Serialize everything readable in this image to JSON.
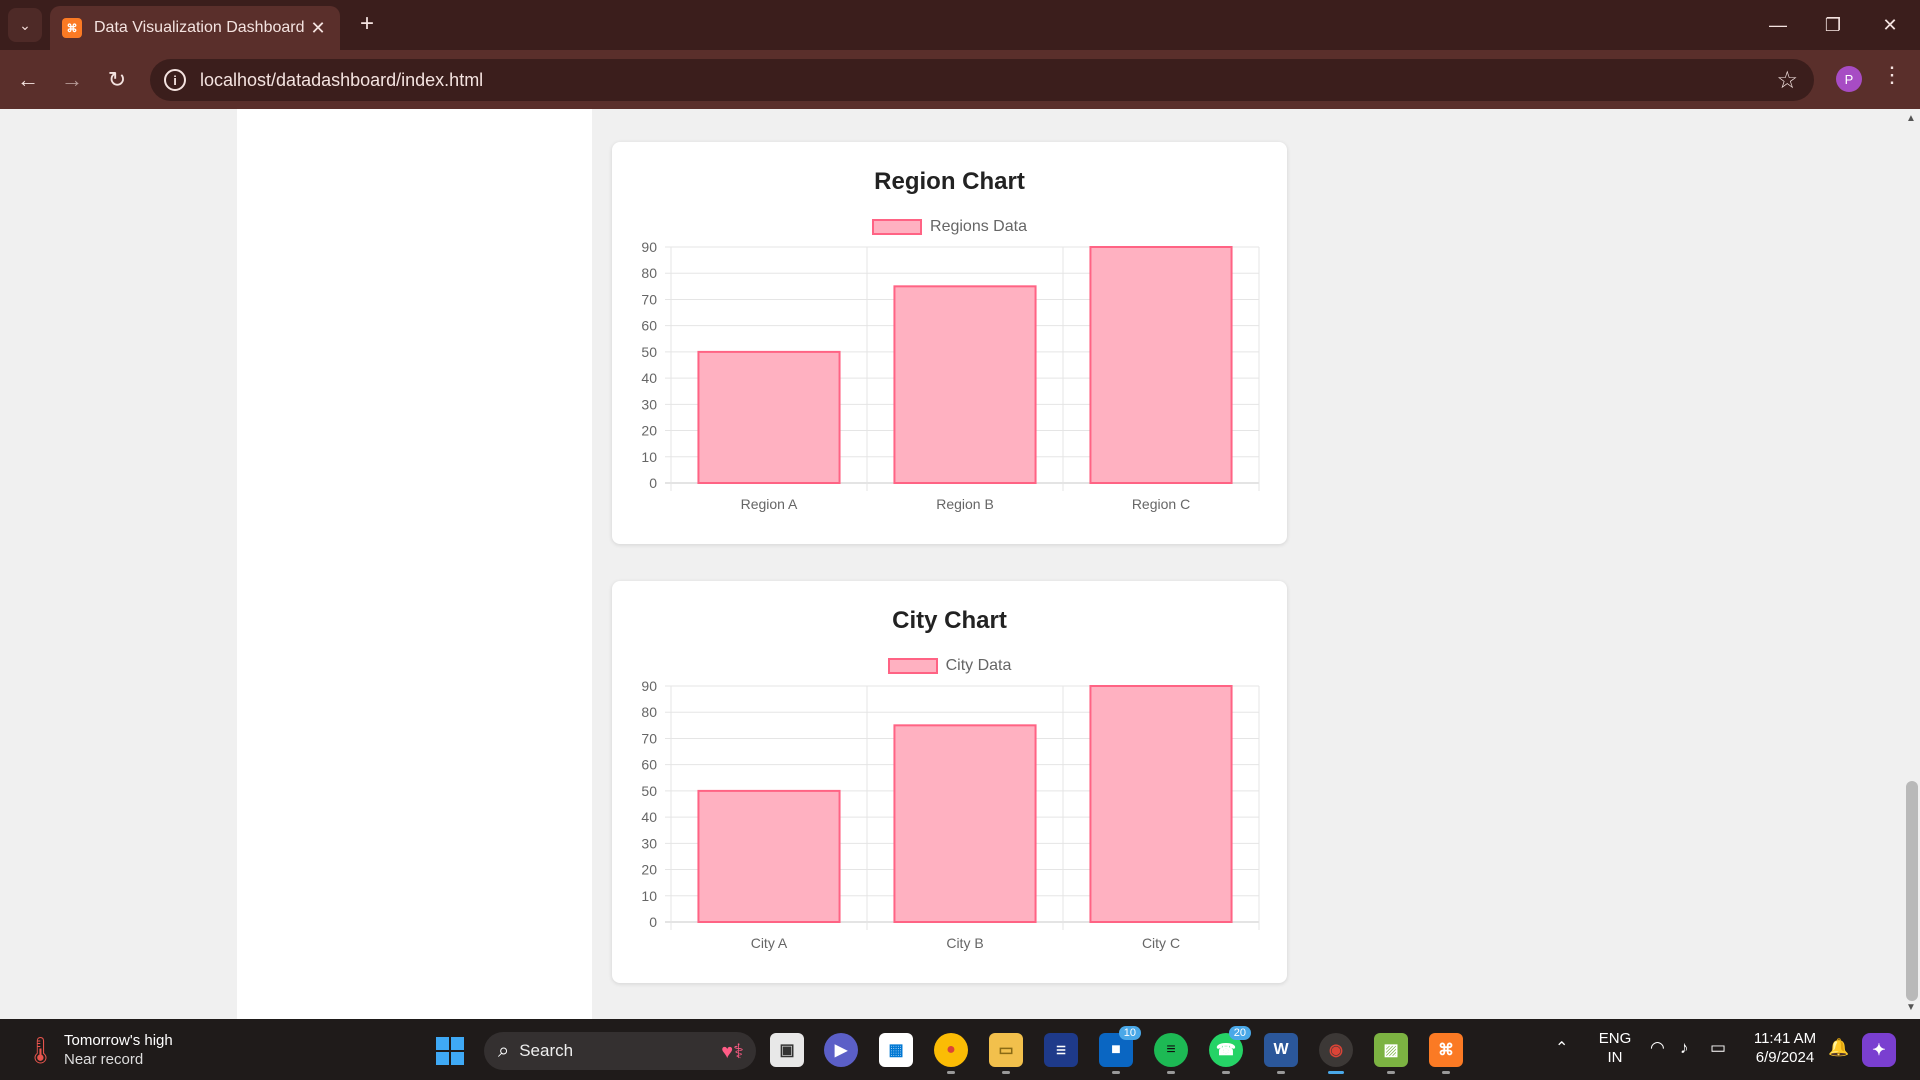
{
  "browser": {
    "tab_title": "Data Visualization Dashboard",
    "url": "localhost/datadashboard/index.html",
    "profile_initial": "P"
  },
  "charts": [
    {
      "title": "Region Chart",
      "legend": "Regions Data",
      "y_ticks": [
        "90",
        "80",
        "70",
        "60",
        "50",
        "40",
        "30",
        "20",
        "10",
        "0"
      ],
      "x_labels": [
        "Region A",
        "Region B",
        "Region C"
      ]
    },
    {
      "title": "City Chart",
      "legend": "City Data",
      "y_ticks": [
        "90",
        "80",
        "70",
        "60",
        "50",
        "40",
        "30",
        "20",
        "10",
        "0"
      ],
      "x_labels": [
        "City A",
        "City B",
        "City C"
      ]
    }
  ],
  "chart_data": [
    {
      "type": "bar",
      "title": "Region Chart",
      "categories": [
        "Region A",
        "Region B",
        "Region C"
      ],
      "series": [
        {
          "name": "Regions Data",
          "values": [
            50,
            75,
            90
          ]
        }
      ],
      "ylim": [
        0,
        90
      ],
      "grid": true,
      "legend_position": "top",
      "colors": {
        "fill": "#ffb1c1",
        "border": "#ff6384"
      }
    },
    {
      "type": "bar",
      "title": "City Chart",
      "categories": [
        "City A",
        "City B",
        "City C"
      ],
      "series": [
        {
          "name": "City Data",
          "values": [
            50,
            75,
            90
          ]
        }
      ],
      "ylim": [
        0,
        90
      ],
      "grid": true,
      "legend_position": "top",
      "colors": {
        "fill": "#ffb1c1",
        "border": "#ff6384"
      }
    }
  ],
  "taskbar": {
    "weather_title": "Tomorrow's high",
    "weather_sub": "Near record",
    "search_label": "Search",
    "store_badge": "10",
    "whatsapp_badge": "20",
    "lang_top": "ENG",
    "lang_bottom": "IN",
    "time": "11:41 AM",
    "date": "6/9/2024"
  }
}
